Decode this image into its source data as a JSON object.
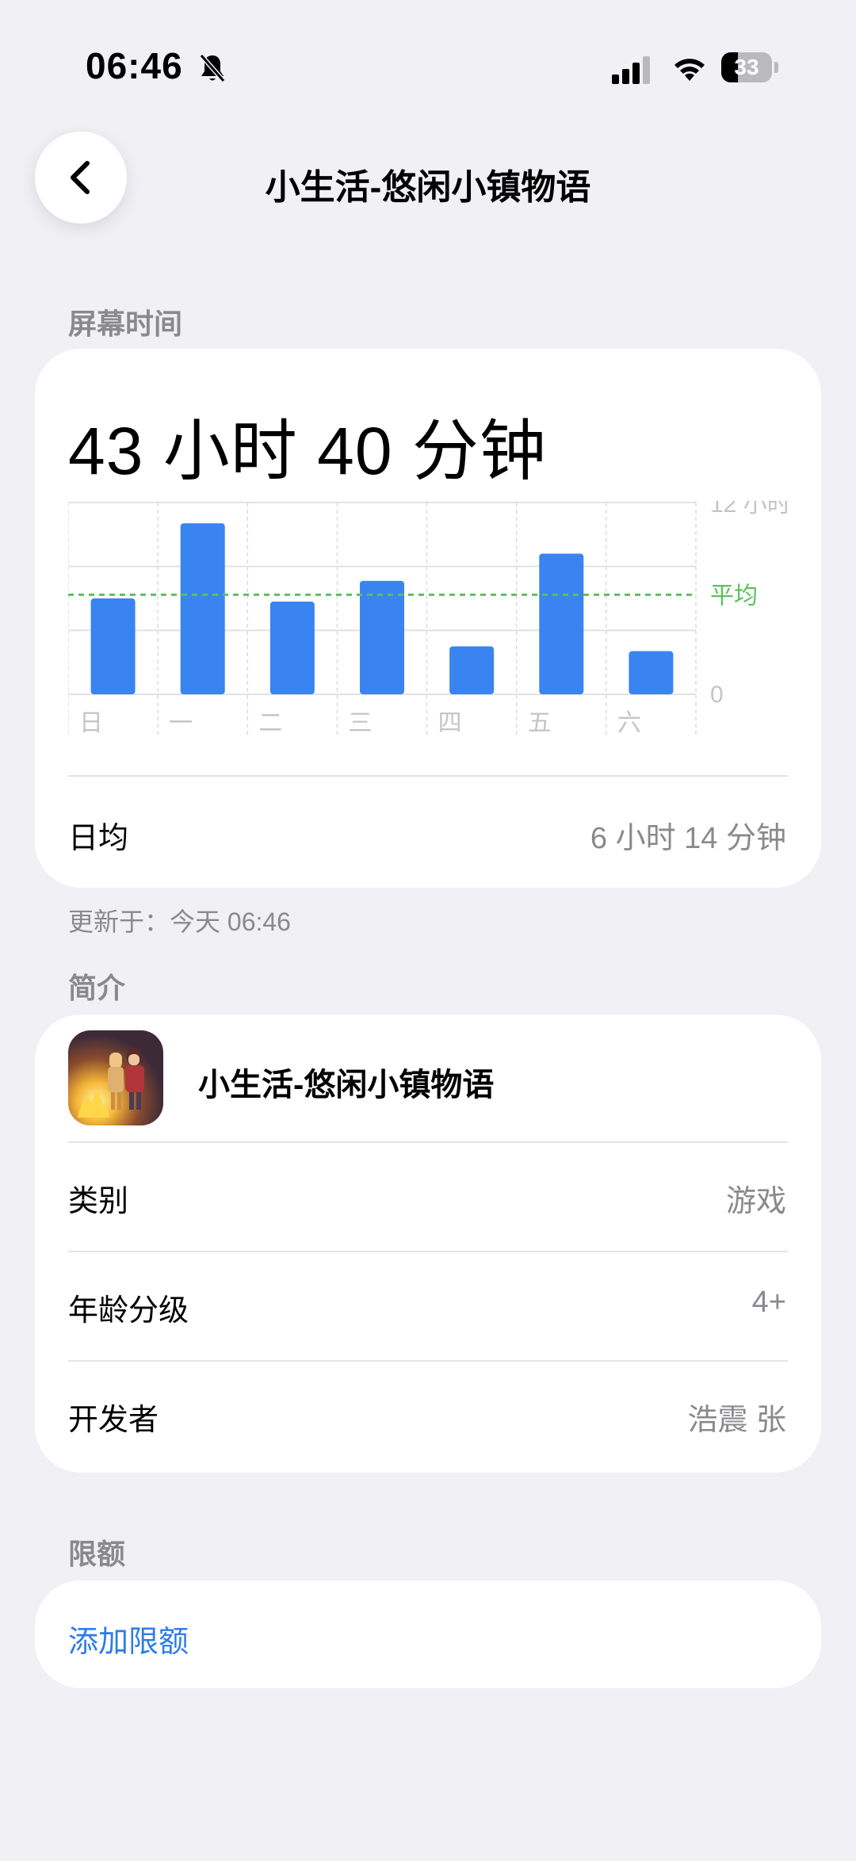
{
  "status_bar": {
    "time": "06:46",
    "battery": "33",
    "battery_level": 0.33,
    "icons": [
      "bell-slash-icon",
      "signal-icon",
      "wifi-icon",
      "battery-icon"
    ]
  },
  "header": {
    "title": "小生活-悠闲小镇物语",
    "back_icon": "chevron-left-icon"
  },
  "screen_time": {
    "section_label": "屏幕时间",
    "total": "43 小时 40 分钟",
    "average_label": "日均",
    "average_value": "6 小时 14 分钟",
    "updated": "更新于：今天 06:46"
  },
  "chart_data": {
    "type": "bar",
    "categories": [
      "日",
      "一",
      "二",
      "三",
      "四",
      "五",
      "六"
    ],
    "values": [
      6.0,
      10.7,
      5.8,
      7.1,
      3.0,
      8.8,
      2.7
    ],
    "ylim": [
      0,
      12
    ],
    "y_tick_labels": [
      "12 小时",
      "0"
    ],
    "average_label": "平均",
    "average_value": 6.23,
    "bar_color": "#3a84f1",
    "average_color": "#5cc05c",
    "grid": true
  },
  "intro": {
    "section_label": "简介",
    "app_name": "小生活-悠闲小镇物语",
    "rows": [
      {
        "label": "类别",
        "value": "游戏"
      },
      {
        "label": "年龄分级",
        "value": "4+"
      },
      {
        "label": "开发者",
        "value": "浩震 张"
      }
    ]
  },
  "limit": {
    "section_label": "限额",
    "add_label": "添加限额"
  },
  "colors": {
    "background": "#f0f0f5",
    "accent": "#2f7ce8",
    "secondary_text": "#8a8a8e"
  }
}
